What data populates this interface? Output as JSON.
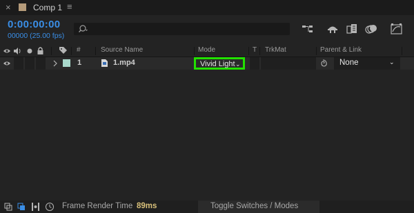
{
  "tab": {
    "close_glyph": "×",
    "title": "Comp 1",
    "menu_glyph": "≡"
  },
  "timecode": {
    "time": "0:00:00:00",
    "frames_fps": "00000 (25.00 fps)"
  },
  "search": {
    "placeholder": ""
  },
  "columns": {
    "number": "#",
    "source_name": "Source Name",
    "mode": "Mode",
    "t": "T",
    "trkmat": "TrkMat",
    "parent_link": "Parent & Link"
  },
  "layer": {
    "number": "1",
    "name": "1.mp4",
    "mode": "Vivid Light",
    "parent": "None",
    "label_color": "#a9d9cc"
  },
  "footer": {
    "frame_render_label": "Frame Render Time",
    "frame_render_value": "89ms",
    "toggle_label": "Toggle Switches / Modes"
  },
  "colors": {
    "timecode": "#3a8ee6",
    "highlight": "#22e000",
    "render_value": "#d8c07a"
  },
  "icons": [
    "close-icon",
    "menu-icon",
    "search-icon",
    "flowchart-icon",
    "draft-3d-icon",
    "frame-blending-icon",
    "motion-blur-icon",
    "graph-editor-icon",
    "eye-icon",
    "audio-icon",
    "solo-icon",
    "lock-icon",
    "label-icon",
    "expand-arrow-icon",
    "footage-icon",
    "pickwhip-icon",
    "chevron-down-icon"
  ]
}
